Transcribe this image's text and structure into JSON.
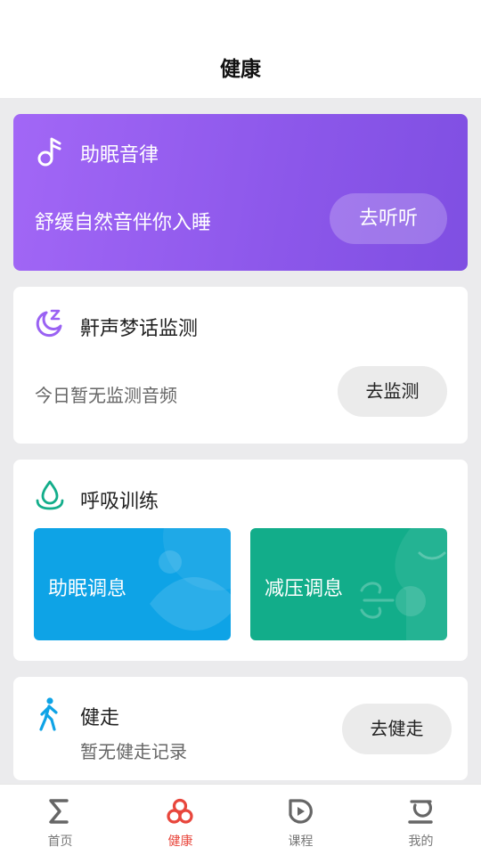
{
  "header": {
    "title": "健康"
  },
  "music_card": {
    "title": "助眠音律",
    "subtitle": "舒缓自然音伴你入睡",
    "button_label": "去听听",
    "icon": "music-note-icon"
  },
  "snore_card": {
    "title": "鼾声梦话监测",
    "status": "今日暂无监测音频",
    "button_label": "去监测",
    "icon": "moon-zzz-icon"
  },
  "breath_card": {
    "title": "呼吸训练",
    "icon": "droplet-icon",
    "tiles": [
      {
        "label": "助眠调息",
        "color": "#0ea3e6"
      },
      {
        "label": "减压调息",
        "color": "#12ad8a"
      }
    ]
  },
  "walk_card": {
    "title": "健走",
    "status": "暂无健走记录",
    "button_label": "去健走",
    "icon": "walking-person-icon"
  },
  "bottom_nav": {
    "items": [
      {
        "label": "首页",
        "icon": "sigma-icon",
        "active": false
      },
      {
        "label": "健康",
        "icon": "health-rings-icon",
        "active": true
      },
      {
        "label": "课程",
        "icon": "play-circle-icon",
        "active": false
      },
      {
        "label": "我的",
        "icon": "profile-icon",
        "active": false
      }
    ]
  },
  "colors": {
    "accent_purple": "#9a62f3",
    "active_nav": "#e8463c",
    "breath_blue": "#0ea3e6",
    "breath_green": "#12ad8a"
  }
}
